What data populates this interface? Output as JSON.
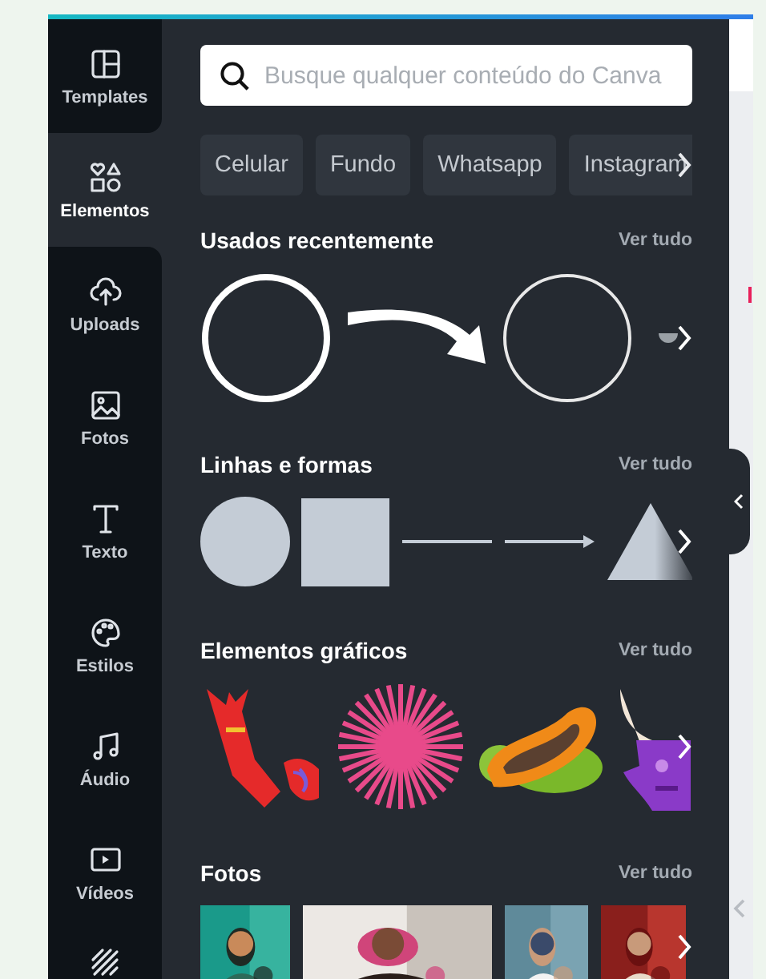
{
  "sidebar": {
    "items": [
      {
        "label": "Templates",
        "kind": "templates",
        "selected": false
      },
      {
        "label": "Elementos",
        "kind": "elements",
        "selected": true
      },
      {
        "label": "Uploads",
        "kind": "uploads",
        "selected": false
      },
      {
        "label": "Fotos",
        "kind": "photos",
        "selected": false
      },
      {
        "label": "Texto",
        "kind": "text",
        "selected": false
      },
      {
        "label": "Estilos",
        "kind": "styles",
        "selected": false
      },
      {
        "label": "Áudio",
        "kind": "audio",
        "selected": false
      },
      {
        "label": "Vídeos",
        "kind": "videos",
        "selected": false
      },
      {
        "kind": "patterns",
        "selected": false
      }
    ]
  },
  "search": {
    "placeholder": "Busque qualquer conteúdo do Canva"
  },
  "chips": [
    "Celular",
    "Fundo",
    "Whatsapp",
    "Instagram"
  ],
  "sections": [
    {
      "title": "Usados recentemente",
      "link": "Ver tudo",
      "kind": "recent"
    },
    {
      "title": "Linhas e formas",
      "link": "Ver tudo",
      "kind": "shapes"
    },
    {
      "title": "Elementos gráficos",
      "link": "Ver tudo",
      "kind": "graphics"
    },
    {
      "title": "Fotos",
      "link": "Ver tudo",
      "kind": "photos"
    }
  ]
}
